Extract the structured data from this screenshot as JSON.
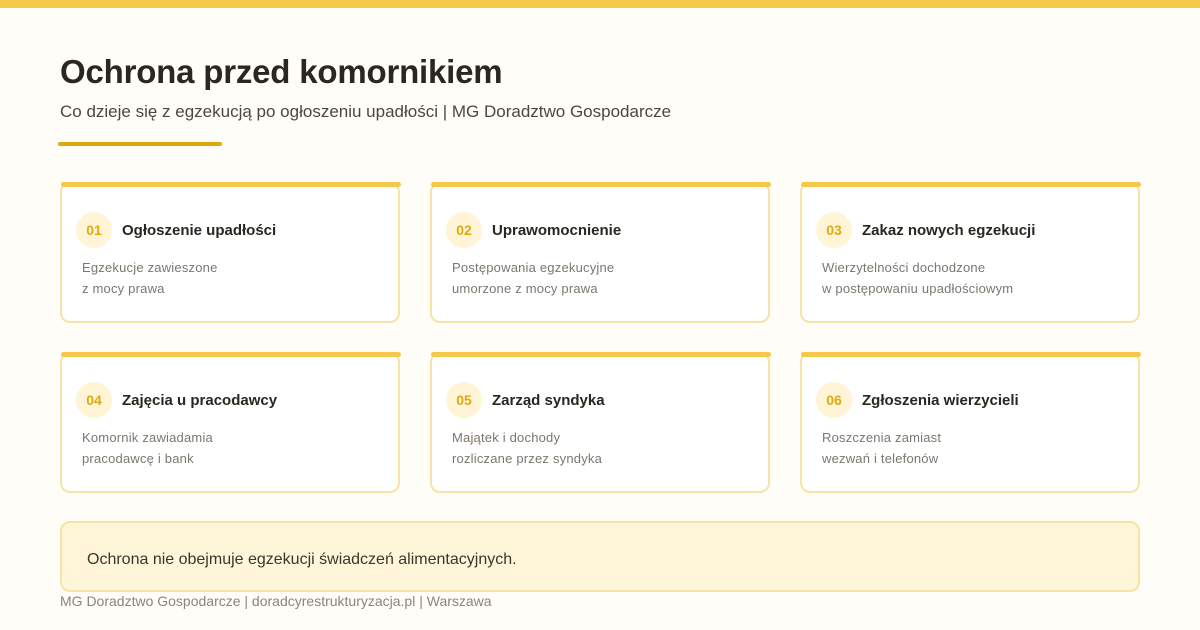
{
  "header": {
    "title": "Ochrona przed komornikiem",
    "subtitle": "Co dzieje się z egzekucją po ogłoszeniu upadłości | MG Doradztwo Gospodarcze"
  },
  "cards": [
    {
      "num": "01",
      "title": "Ogłoszenie upadłości",
      "desc": "Egzekucje zawieszone\nz mocy prawa"
    },
    {
      "num": "02",
      "title": "Uprawomocnienie",
      "desc": "Postępowania egzekucyjne\numorzone z mocy prawa"
    },
    {
      "num": "03",
      "title": "Zakaz nowych egzekucji",
      "desc": "Wierzytelności dochodzone\nw postępowaniu upadłościowym"
    },
    {
      "num": "04",
      "title": "Zajęcia u pracodawcy",
      "desc": "Komornik zawiadamia\npracodawcę i bank"
    },
    {
      "num": "05",
      "title": "Zarząd syndyka",
      "desc": "Majątek i dochody\nrozliczane przez syndyka"
    },
    {
      "num": "06",
      "title": "Zgłoszenia wierzycieli",
      "desc": "Roszczenia zamiast\nwezwań i telefonów"
    }
  ],
  "note": {
    "text": "Ochrona nie obejmuje egzekucji świadczeń alimentacyjnych."
  },
  "footer": {
    "text": "MG Doradztwo Gospodarcze | doradcyrestrukturyzacja.pl | Warszawa"
  },
  "colors": {
    "accent": "#f7c948",
    "accent_dark": "#e0a80f",
    "card_border": "#f7e3a6",
    "number_badge_bg": "#fff4d6",
    "number_text": "#dcab12",
    "note_bg": "#fff6da",
    "page_bg": "#fffdf7"
  }
}
